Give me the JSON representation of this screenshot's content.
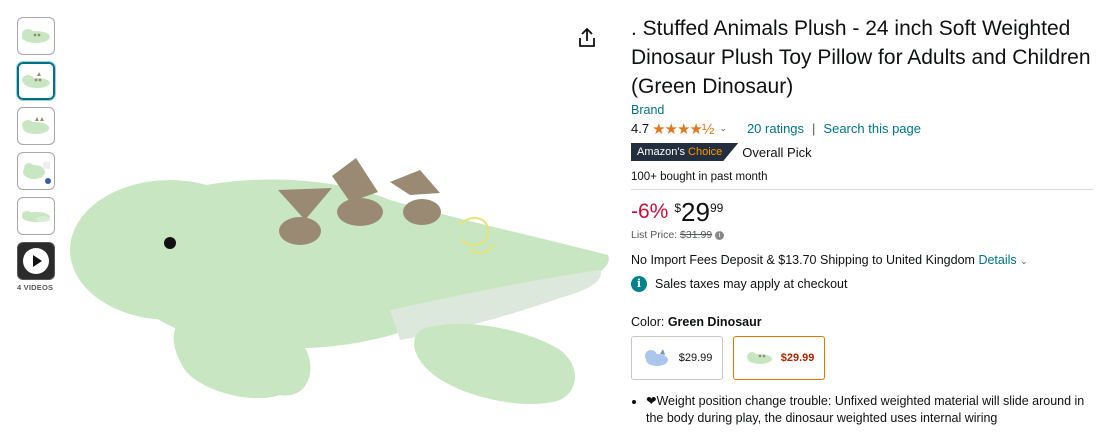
{
  "thumbnails": {
    "items": [
      {
        "name": "thumb-1",
        "selected": false
      },
      {
        "name": "thumb-2",
        "selected": true
      },
      {
        "name": "thumb-3",
        "selected": false
      },
      {
        "name": "thumb-4",
        "selected": false
      },
      {
        "name": "thumb-5",
        "selected": false
      },
      {
        "name": "thumb-video",
        "selected": false
      }
    ],
    "videos_label": "4 VIDEOS"
  },
  "product": {
    "title_blurred": "               ",
    "title": ". Stuffed Animals Plush - 24 inch Soft Weighted Dinosaur Plush Toy Pillow for Adults and Children (Green Dinosaur)",
    "brand": "Brand",
    "rating": "4.7",
    "rating_stars": "★★★★½",
    "ratings_count": "20 ratings",
    "search_link": "Search this page",
    "badge_prefix": "Amazon's",
    "badge_choice": "Choice",
    "badge_label": "Overall Pick",
    "bought": "100+ bought in past month",
    "discount": "-6%",
    "currency": "$",
    "price_whole": "29",
    "price_fraction": "99",
    "list_price_label": "List Price:",
    "list_price": "$31.99",
    "shipping_text": "No Import Fees Deposit & $13.70 Shipping to United Kingdom",
    "shipping_details": "Details",
    "tax_text": "Sales taxes may apply at checkout",
    "color_label": "Color:",
    "color_value": "Green Dinosaur",
    "swatches": [
      {
        "price": "$29.99",
        "selected": false,
        "color": "#aac6ea"
      },
      {
        "price": "$29.99",
        "selected": true,
        "color": "#c7e6c0"
      }
    ],
    "bullets": [
      "❤Weight position change trouble: Unfixed weighted material will slide around in the body during play, the dinosaur weighted uses internal wiring"
    ]
  },
  "colors": {
    "link": "#007185",
    "discount": "#cc0c39",
    "star": "#de7921",
    "dino_body": "#c8e6c2",
    "dino_spot": "#9a8a74"
  }
}
